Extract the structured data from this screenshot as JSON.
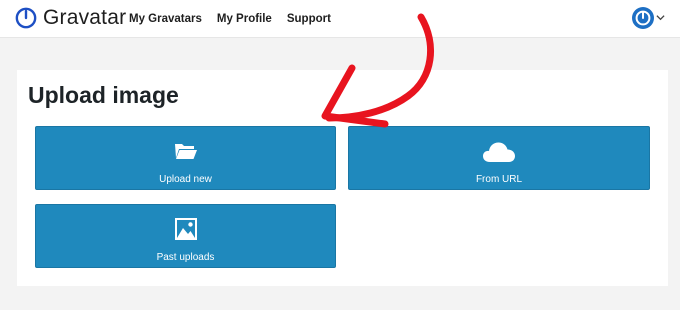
{
  "header": {
    "brand": "Gravatar",
    "nav": [
      {
        "label": "My Gravatars"
      },
      {
        "label": "My Profile"
      },
      {
        "label": "Support"
      }
    ]
  },
  "main": {
    "title": "Upload image",
    "options": [
      {
        "label": "Upload new",
        "icon": "folder-open-icon"
      },
      {
        "label": "From URL",
        "icon": "cloud-icon"
      },
      {
        "label": "Past uploads",
        "icon": "image-icon"
      }
    ]
  },
  "annotation": {
    "icon": "red-arrow-icon",
    "color": "#e8141f"
  },
  "colors": {
    "tile": "#1f89bd",
    "brand": "#1d4fc4"
  }
}
